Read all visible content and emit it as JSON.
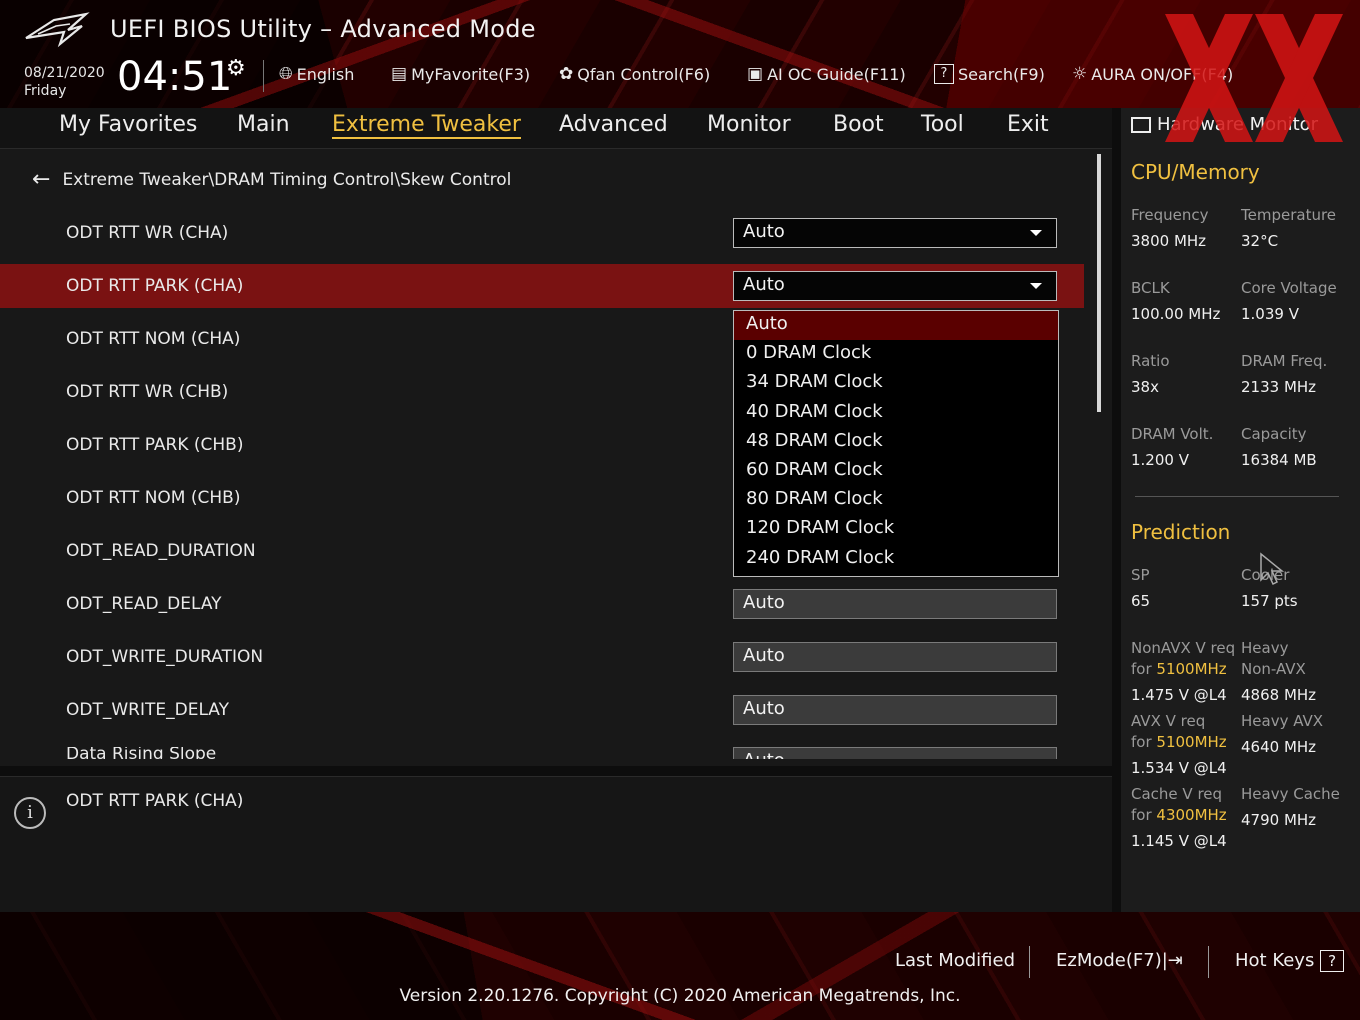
{
  "header": {
    "title": "UEFI BIOS Utility – Advanced Mode",
    "date": "08/21/2020",
    "day": "Friday",
    "time": "04:51",
    "toolbar": [
      {
        "label": "English",
        "icon": "globe-icon"
      },
      {
        "label": "MyFavorite(F3)",
        "icon": "favorite-icon"
      },
      {
        "label": "Qfan Control(F6)",
        "icon": "fan-icon"
      },
      {
        "label": "AI OC Guide(F11)",
        "icon": "ai-icon"
      },
      {
        "label": "Search(F9)",
        "icon": "search-icon"
      },
      {
        "label": "AURA ON/OFF(F4)",
        "icon": "aura-icon"
      }
    ]
  },
  "tabs": [
    "My Favorites",
    "Main",
    "Extreme Tweaker",
    "Advanced",
    "Monitor",
    "Boot",
    "Tool",
    "Exit"
  ],
  "active_tab": "Extreme Tweaker",
  "breadcrumb": "Extreme Tweaker\\DRAM Timing Control\\Skew Control",
  "settings": [
    {
      "label": "ODT RTT WR (CHA)",
      "value": "Auto",
      "kind": "dropdown"
    },
    {
      "label": "ODT RTT PARK (CHA)",
      "value": "Auto",
      "kind": "dropdown",
      "selected": true
    },
    {
      "label": "ODT RTT NOM (CHA)",
      "value": "",
      "kind": "hidden"
    },
    {
      "label": "ODT RTT WR (CHB)",
      "value": "",
      "kind": "hidden"
    },
    {
      "label": "ODT RTT PARK (CHB)",
      "value": "",
      "kind": "hidden"
    },
    {
      "label": "ODT RTT NOM (CHB)",
      "value": "",
      "kind": "hidden"
    },
    {
      "label": "ODT_READ_DURATION",
      "value": "",
      "kind": "hidden"
    },
    {
      "label": "ODT_READ_DELAY",
      "value": "Auto",
      "kind": "text"
    },
    {
      "label": "ODT_WRITE_DURATION",
      "value": "Auto",
      "kind": "text"
    },
    {
      "label": "ODT_WRITE_DELAY",
      "value": "Auto",
      "kind": "text"
    },
    {
      "label": "Data Rising Slope",
      "value": "Auto",
      "kind": "text"
    }
  ],
  "dropdown_options": [
    "Auto",
    "0 DRAM Clock",
    "34 DRAM Clock",
    "40 DRAM Clock",
    "48 DRAM Clock",
    "60 DRAM Clock",
    "80 DRAM Clock",
    "120 DRAM Clock",
    "240 DRAM Clock"
  ],
  "dropdown_selected": "Auto",
  "help_text": "ODT RTT PARK (CHA)",
  "hardware_monitor": {
    "title": "Hardware Monitor",
    "cpu_memory": {
      "heading": "CPU/Memory",
      "items": [
        {
          "label": "Frequency",
          "value": "3800 MHz"
        },
        {
          "label": "Temperature",
          "value": "32°C"
        },
        {
          "label": "BCLK",
          "value": "100.00 MHz"
        },
        {
          "label": "Core Voltage",
          "value": "1.039 V"
        },
        {
          "label": "Ratio",
          "value": "38x"
        },
        {
          "label": "DRAM Freq.",
          "value": "2133 MHz"
        },
        {
          "label": "DRAM Volt.",
          "value": "1.200 V"
        },
        {
          "label": "Capacity",
          "value": "16384 MB"
        }
      ]
    },
    "prediction": {
      "heading": "Prediction",
      "sp_label": "SP",
      "sp_value": "65",
      "cooler_label": "Cooler",
      "cooler_value": "157 pts",
      "nonavx_label": "NonAVX V req",
      "for_word": "for",
      "nonavx_freq": "5100MHz",
      "nonavx_value": "1.475 V @L4",
      "heavy_nonavx_label1": "Heavy",
      "heavy_nonavx_label2": "Non-AVX",
      "heavy_nonavx_value": "4868 MHz",
      "avx_label": "AVX V req",
      "avx_freq": "5100MHz",
      "avx_value": "1.534 V @L4",
      "heavy_avx_label": "Heavy AVX",
      "heavy_avx_value": "4640 MHz",
      "cache_label": "Cache V req",
      "cache_freq": "4300MHz",
      "cache_value": "1.145 V @L4",
      "heavy_cache_label": "Heavy Cache",
      "heavy_cache_value": "4790 MHz"
    }
  },
  "footer": {
    "last_modified": "Last Modified",
    "ezmode": "EzMode(F7)|",
    "hotkeys": "Hot Keys",
    "hotkeys_key": "?",
    "version": "Version 2.20.1276. Copyright (C) 2020 American Megatrends, Inc."
  },
  "colors": {
    "accent": "#f0c040",
    "selected_row": "#7a1212",
    "dropdown_selected": "#5a0000"
  }
}
